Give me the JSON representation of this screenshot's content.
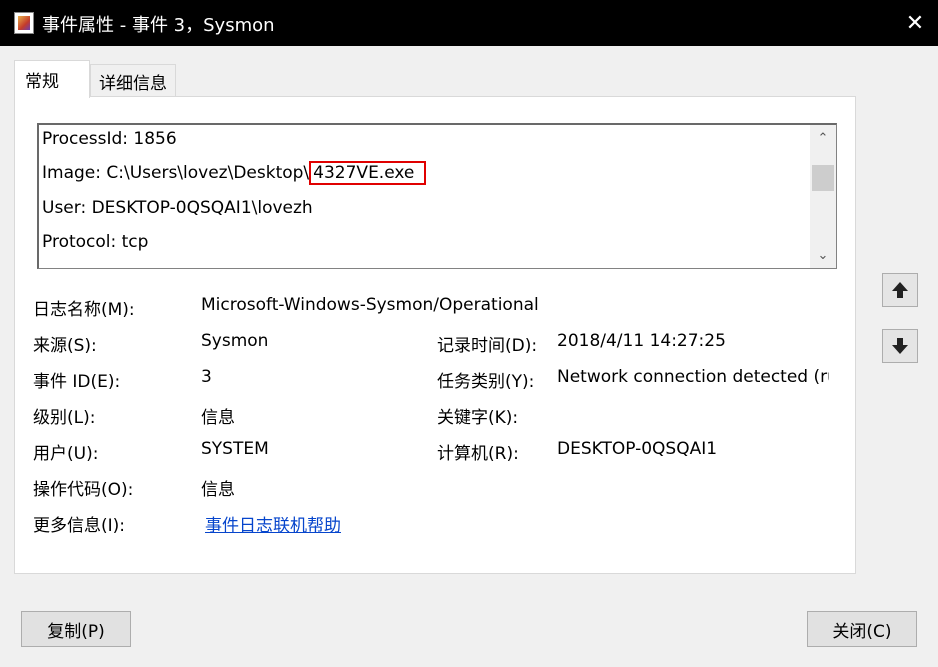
{
  "window": {
    "title": "事件属性 - 事件 3，Sysmon",
    "close_glyph": "✕"
  },
  "tabs": [
    {
      "label": "常规",
      "active": true
    },
    {
      "label": "详细信息",
      "active": false
    }
  ],
  "description": {
    "lines": [
      "ProcessId: 1856",
      "Image: C:\\Users\\lovez\\Desktop\\",
      "User: DESKTOP-0QSQAI1\\lovezh",
      "Protocol: tcp"
    ],
    "highlighted_text": "4327VE.exe",
    "highlight_color": "#e00000",
    "scroll_up_glyph": "⌃",
    "scroll_down_glyph": "⌄"
  },
  "fields": {
    "log_name": {
      "label": "日志名称(M):",
      "value": "Microsoft-Windows-Sysmon/Operational"
    },
    "source": {
      "label": "来源(S):",
      "value": "Sysmon"
    },
    "logged": {
      "label": "记录时间(D):",
      "value": "2018/4/11 14:27:25"
    },
    "event_id": {
      "label": "事件 ID(E):",
      "value": "3"
    },
    "task_category": {
      "label": "任务类别(Y):",
      "value": "Network connection detected (ru"
    },
    "level": {
      "label": "级别(L):",
      "value": "信息"
    },
    "keywords": {
      "label": "关键字(K):",
      "value": ""
    },
    "user": {
      "label": "用户(U):",
      "value": "SYSTEM"
    },
    "computer": {
      "label": "计算机(R):",
      "value": "DESKTOP-0QSQAI1"
    },
    "opcode": {
      "label": "操作代码(O):",
      "value": "信息"
    },
    "more_info": {
      "label": "更多信息(I):",
      "value": "事件日志联机帮助"
    }
  },
  "link_color": "#0645cc",
  "buttons": {
    "copy": "复制(P)",
    "close": "关闭(C)"
  }
}
